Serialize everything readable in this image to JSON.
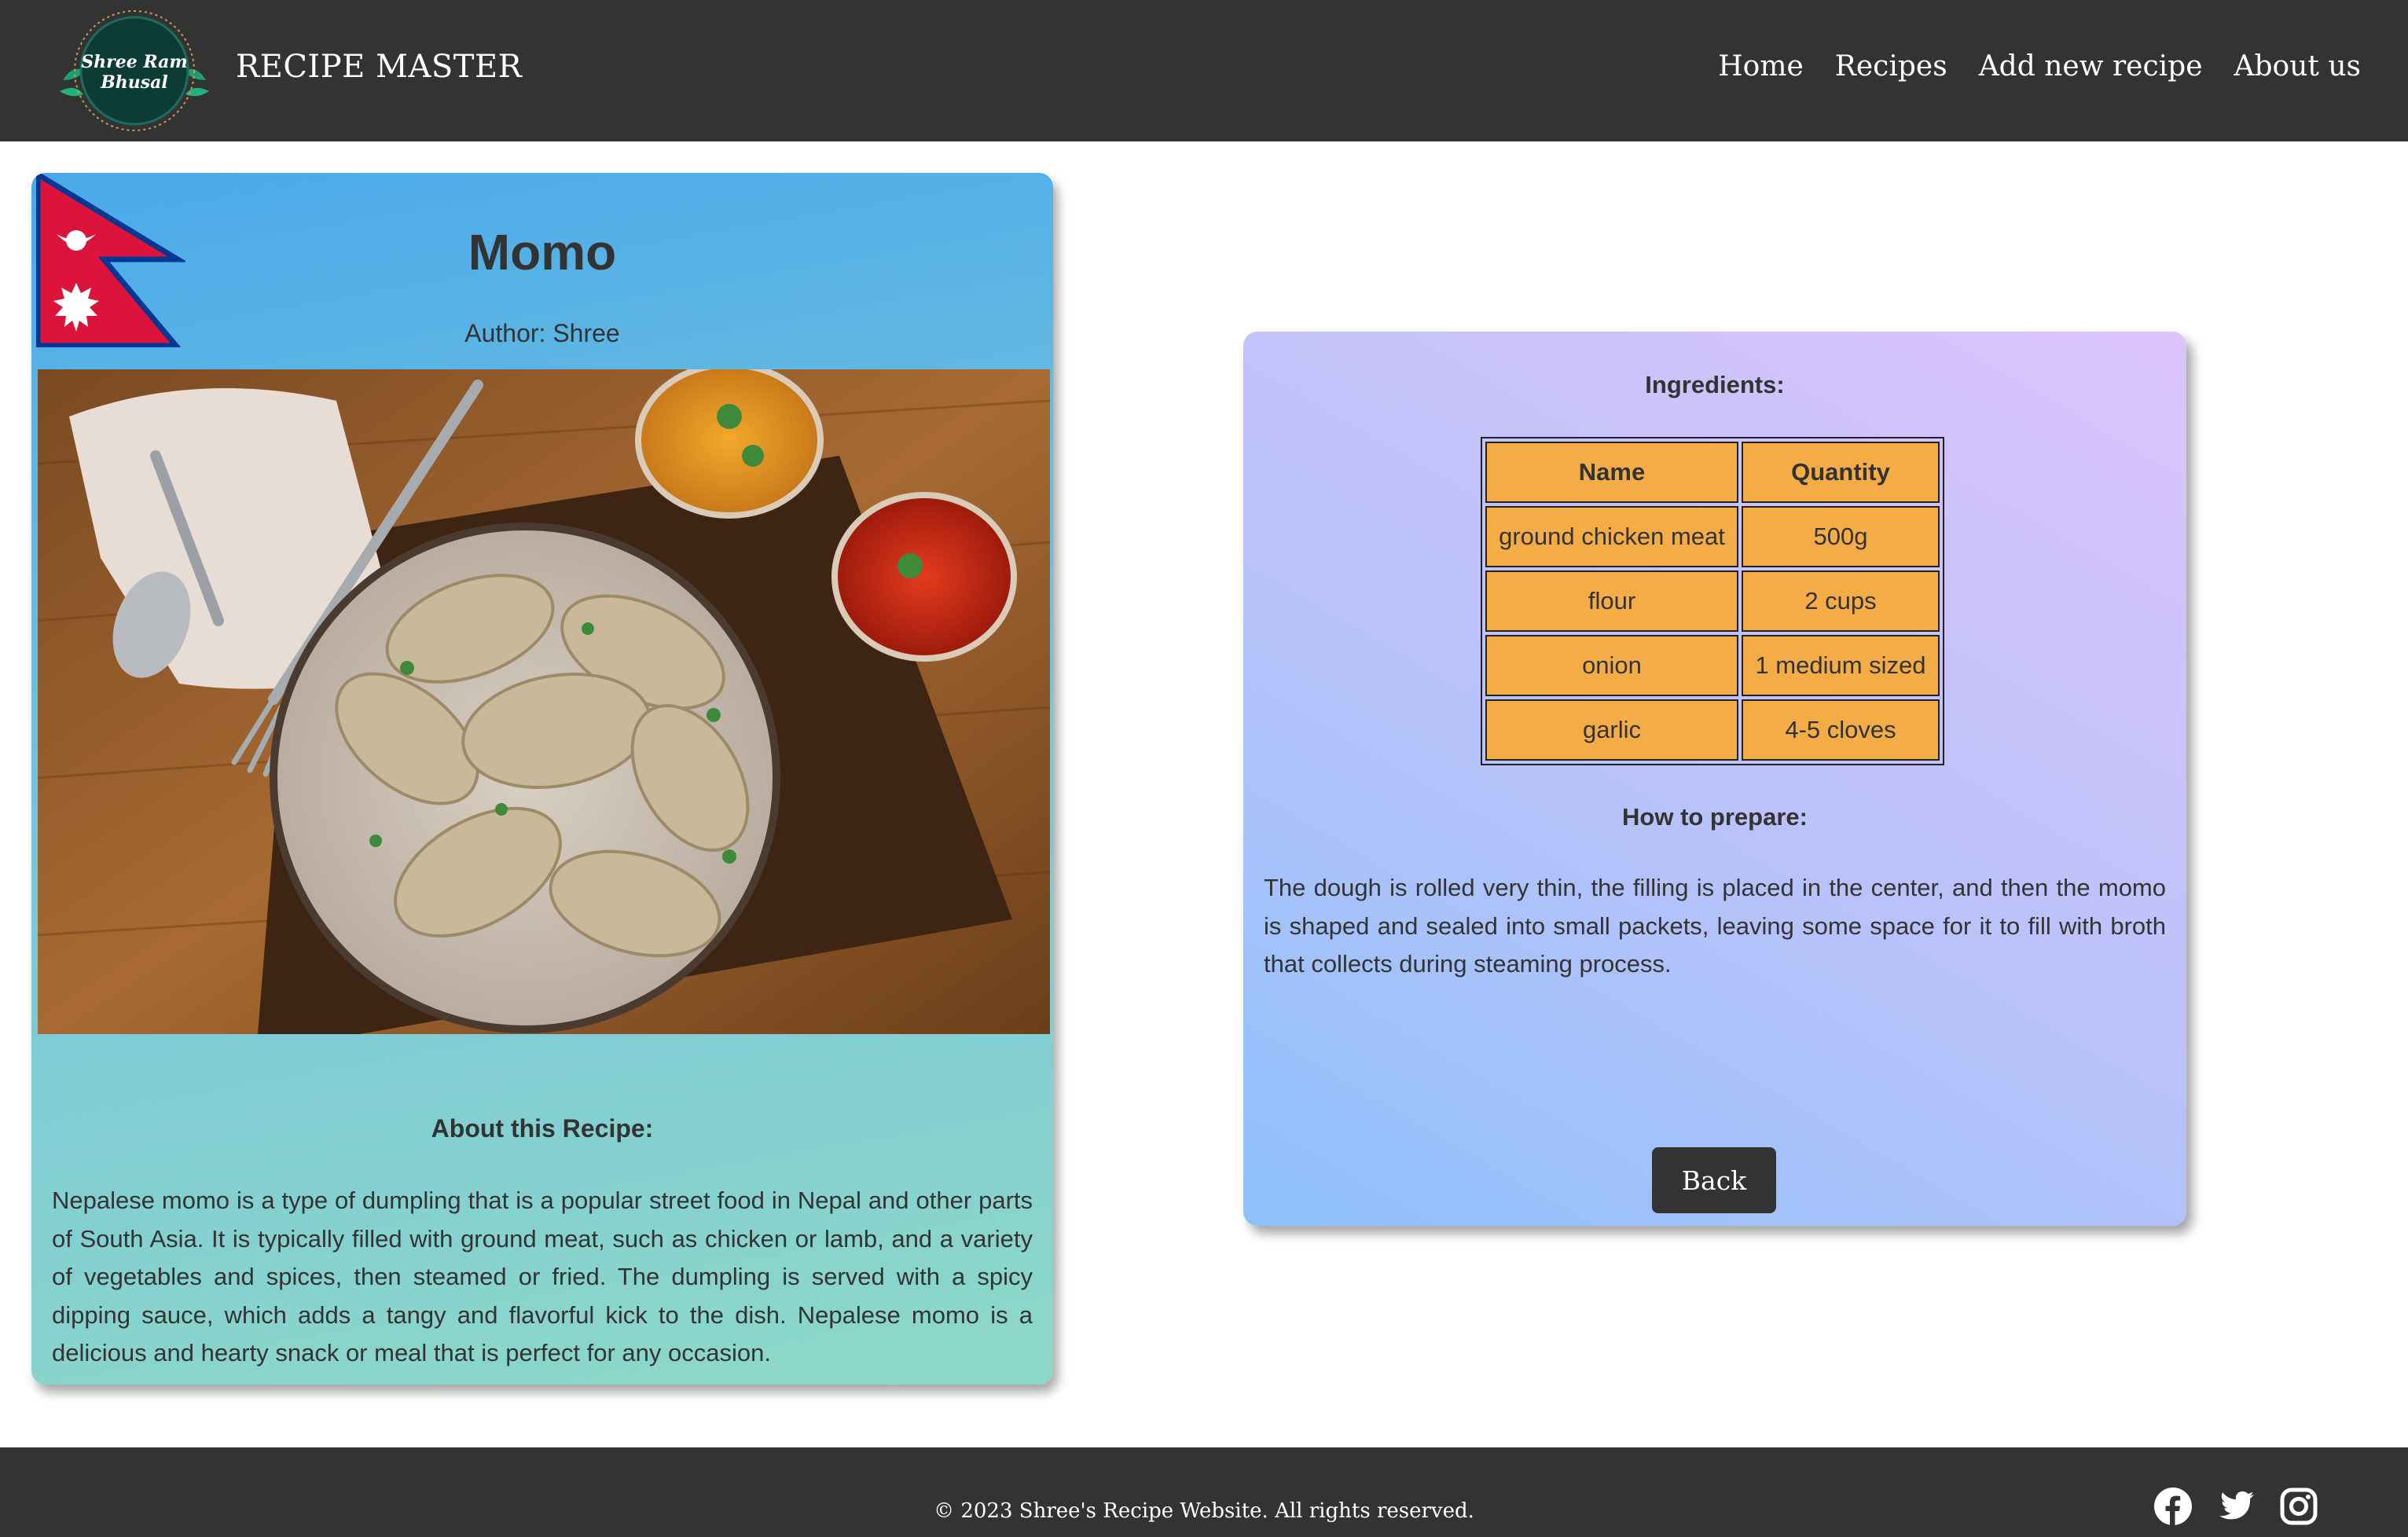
{
  "header": {
    "logo_text": [
      "Shree Ram",
      "Bhusal"
    ],
    "brand": "RECIPE MASTER",
    "nav": [
      "Home",
      "Recipes",
      "Add new recipe",
      "About us"
    ]
  },
  "recipe": {
    "title": "Momo",
    "author": "Author: Shree",
    "about_title": "About this Recipe:",
    "about_text": "Nepalese momo is a type of dumpling that is a popular street food in Nepal and other parts of South Asia. It is typically filled with ground meat, such as chicken or lamb, and a variety of vegetables and spices, then steamed or fried. The dumpling is served with a spicy dipping sauce, which adds a tangy and flavorful kick to the dish. Nepalese momo is a delicious and hearty snack or meal that is perfect for any occasion."
  },
  "ingredients": {
    "title": "Ingredients:",
    "headers": [
      "Name",
      "Quantity"
    ],
    "rows": [
      [
        "ground chicken meat",
        "500g"
      ],
      [
        "flour",
        "2 cups"
      ],
      [
        "onion",
        "1 medium sized"
      ],
      [
        "garlic",
        "4-5 cloves"
      ]
    ]
  },
  "prepare": {
    "title": "How to prepare:",
    "text": "The dough is rolled very thin, the filling is placed in the center, and then the momo is shaped and sealed into small packets, leaving some space for it to fill with broth that collects during steaming process."
  },
  "back_label": "Back",
  "footer": {
    "copyright": "© 2023 Shree's Recipe Website. All rights reserved.",
    "social_icons": [
      "facebook-icon",
      "twitter-icon",
      "instagram-icon"
    ]
  },
  "colors": {
    "header_bg": "#333333",
    "table_cell": "#f4ad46",
    "flag_red": "#dc143c",
    "flag_blue": "#003893"
  }
}
